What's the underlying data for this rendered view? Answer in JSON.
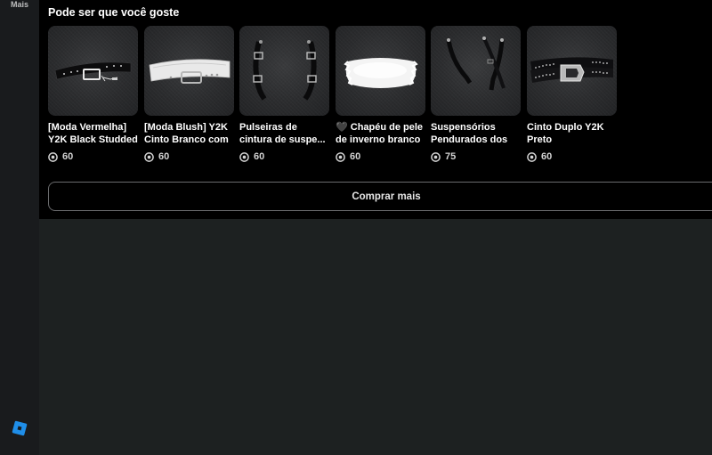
{
  "sidebar": {
    "more_label": "Mais"
  },
  "section": {
    "title": "Pode ser que você goste"
  },
  "items": [
    {
      "name": "[Moda Vermelha] Y2K Black Studded",
      "price": "60",
      "thumbnail": "black-studded-belt"
    },
    {
      "name": "[Moda Blush] Y2K Cinto Branco com",
      "price": "60",
      "thumbnail": "white-belt"
    },
    {
      "name": "Pulseiras de cintura de suspe...",
      "price": "60",
      "thumbnail": "waist-straps"
    },
    {
      "name": "🖤 Chapéu de pele de inverno branco",
      "price": "60",
      "thumbnail": "white-fur-hat"
    },
    {
      "name": "Suspensórios Pendurados dos",
      "price": "75",
      "thumbnail": "hanging-suspenders"
    },
    {
      "name": "Cinto Duplo Y2K Preto",
      "price": "60",
      "thumbnail": "double-belt"
    }
  ],
  "buy_more_label": "Comprar mais",
  "colors": {
    "panel": "#000000",
    "main_bg": "#1d2121",
    "rail": "#191b1d",
    "logo": "#1f8ee8"
  }
}
